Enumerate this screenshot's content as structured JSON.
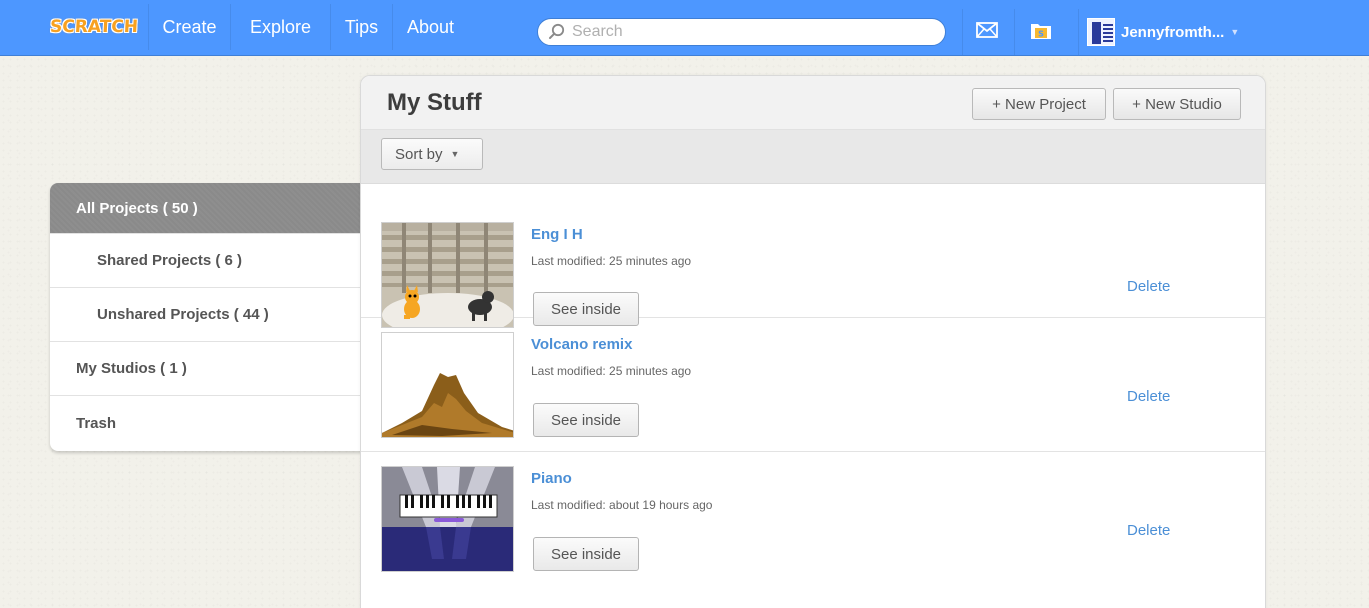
{
  "nav": {
    "logo": "SCRATCH",
    "items": [
      {
        "label": "Create"
      },
      {
        "label": "Explore"
      },
      {
        "label": "Tips"
      },
      {
        "label": "About"
      }
    ],
    "search_placeholder": "Search",
    "messages_icon": "envelope-icon",
    "mystuff_icon": "folder-icon",
    "username": "Jennyfromth..."
  },
  "sidebar": {
    "items": [
      {
        "label": "All Projects ( 50 )"
      },
      {
        "label": "Shared Projects ( 6 )"
      },
      {
        "label": "Unshared Projects ( 44 )"
      },
      {
        "label": "My Studios ( 1 )"
      },
      {
        "label": "Trash"
      }
    ]
  },
  "main": {
    "title": "My Stuff",
    "new_project_label": "+ New Project",
    "new_studio_label": "+ New Studio",
    "sort_label": "Sort by",
    "projects": [
      {
        "title": "Eng I H",
        "modified": "Last modified: 25 minutes ago",
        "see_inside": "See inside",
        "delete": "Delete"
      },
      {
        "title": "Volcano remix",
        "modified": "Last modified: 25 minutes ago",
        "see_inside": "See inside",
        "delete": "Delete"
      },
      {
        "title": "Piano",
        "modified": "Last modified: about 19 hours ago",
        "see_inside": "See inside",
        "delete": "Delete"
      }
    ]
  },
  "colors": {
    "nav_blue": "#4d97ff",
    "link_blue": "#4b8fd6",
    "active_side": "#8a8a8a"
  }
}
